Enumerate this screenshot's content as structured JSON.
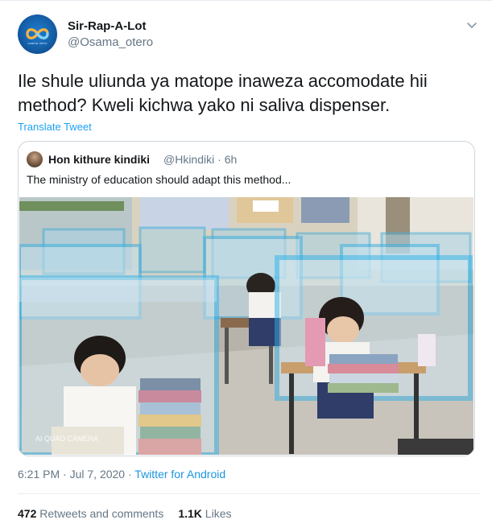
{
  "tweet": {
    "display_name": "Sir-Rap-A-Lot",
    "handle": "@Osama_otero",
    "avatar_text": "osama otero",
    "text": "Ile shule uliunda ya matope inaweza accomodate hii method? Kweli kichwa yako ni saliva dispenser.",
    "translate_label": "Translate Tweet",
    "menu_icon": "chevron-down-icon"
  },
  "quoted": {
    "display_name": "Hon kithure kindiki",
    "handle": "@Hkindiki",
    "separator": " · ",
    "time": "6h",
    "text": "The ministry of education should adapt this method...",
    "image_alt": "Classroom of students at desks enclosed by plastic shields",
    "watermark": "AI QUAD CAMERA"
  },
  "meta": {
    "time": "6:21 PM",
    "dot": " · ",
    "date": "Jul 7, 2020",
    "source": "Twitter for Android"
  },
  "stats": {
    "retweets_count": "472",
    "retweets_label": "Retweets and comments",
    "likes_count": "1.1K",
    "likes_label": "Likes"
  },
  "colors": {
    "accent": "#1da1f2",
    "secondary_text": "#657786",
    "border": "#ccd6dd"
  }
}
